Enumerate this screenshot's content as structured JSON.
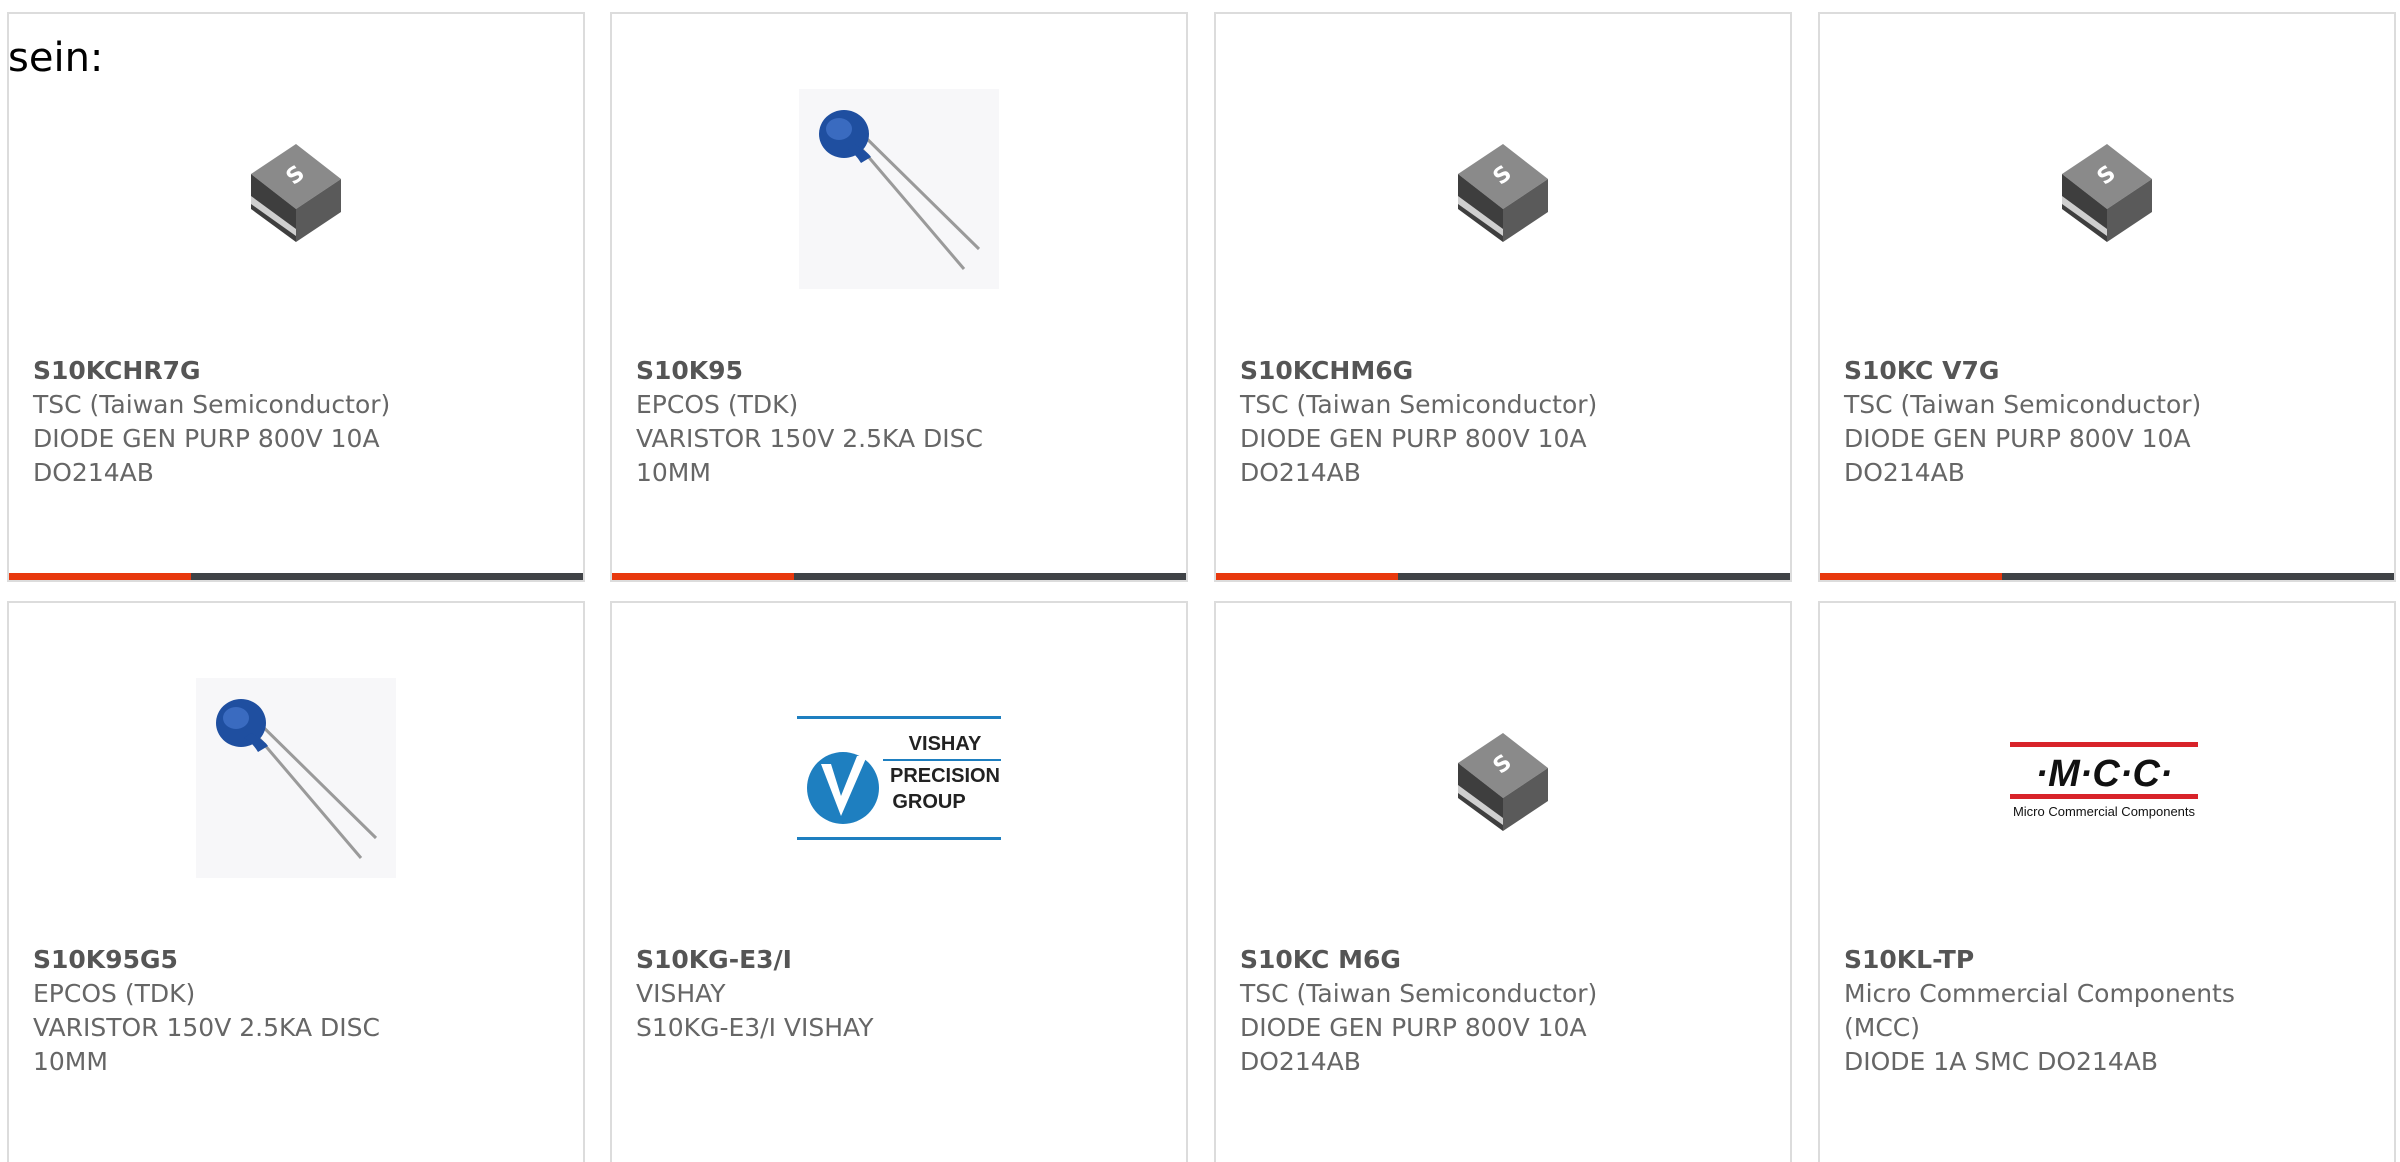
{
  "intro_text": "sein:",
  "cards": [
    {
      "part": "S10KCHR7G",
      "manufacturer": "TSC (Taiwan Semiconductor)",
      "desc1": "DIODE GEN PURP 800V 10A",
      "desc2": "DO214AB",
      "image": "smd-diode-package-icon"
    },
    {
      "part": "S10K95",
      "manufacturer": "EPCOS (TDK)",
      "desc1": "VARISTOR 150V 2.5KA DISC",
      "desc2": "10MM",
      "image": "disc-varistor-icon"
    },
    {
      "part": "S10KCHM6G",
      "manufacturer": "TSC (Taiwan Semiconductor)",
      "desc1": "DIODE GEN PURP 800V 10A",
      "desc2": "DO214AB",
      "image": "smd-diode-package-icon"
    },
    {
      "part": "S10KC V7G",
      "manufacturer": "TSC (Taiwan Semiconductor)",
      "desc1": "DIODE GEN PURP 800V 10A",
      "desc2": "DO214AB",
      "image": "smd-diode-package-icon"
    },
    {
      "part": "S10K95G5",
      "manufacturer": "EPCOS (TDK)",
      "desc1": "VARISTOR 150V 2.5KA DISC",
      "desc2": "10MM",
      "image": "disc-varistor-icon"
    },
    {
      "part": "S10KG-E3/I",
      "manufacturer": "VISHAY",
      "desc1": "S10KG-E3/I VISHAY",
      "desc2": "",
      "image": "vishay-precision-group-logo",
      "logo_lines": [
        "VISHAY",
        "PRECISION",
        "GROUP"
      ]
    },
    {
      "part": "S10KC M6G",
      "manufacturer": "TSC (Taiwan Semiconductor)",
      "desc1": "DIODE GEN PURP 800V 10A",
      "desc2": "DO214AB",
      "image": "smd-diode-package-icon"
    },
    {
      "part": "S10KL-TP",
      "manufacturer": "Micro Commercial Components",
      "manufacturer2": "(MCC)",
      "desc1": "DIODE 1A SMC DO214AB",
      "desc2": "",
      "image": "mcc-logo",
      "logo_main": "·M·C·C·",
      "logo_sub": "Micro Commercial Components"
    }
  ],
  "colors": {
    "accent_bar": "#e8380d",
    "dark_bar": "#3f4246",
    "card_border": "#dcdcdc",
    "text_gray": "#666666",
    "varistor_blue": "#1f4fa0",
    "vishay_blue": "#1e7fc0",
    "mcc_red": "#d8232a"
  }
}
